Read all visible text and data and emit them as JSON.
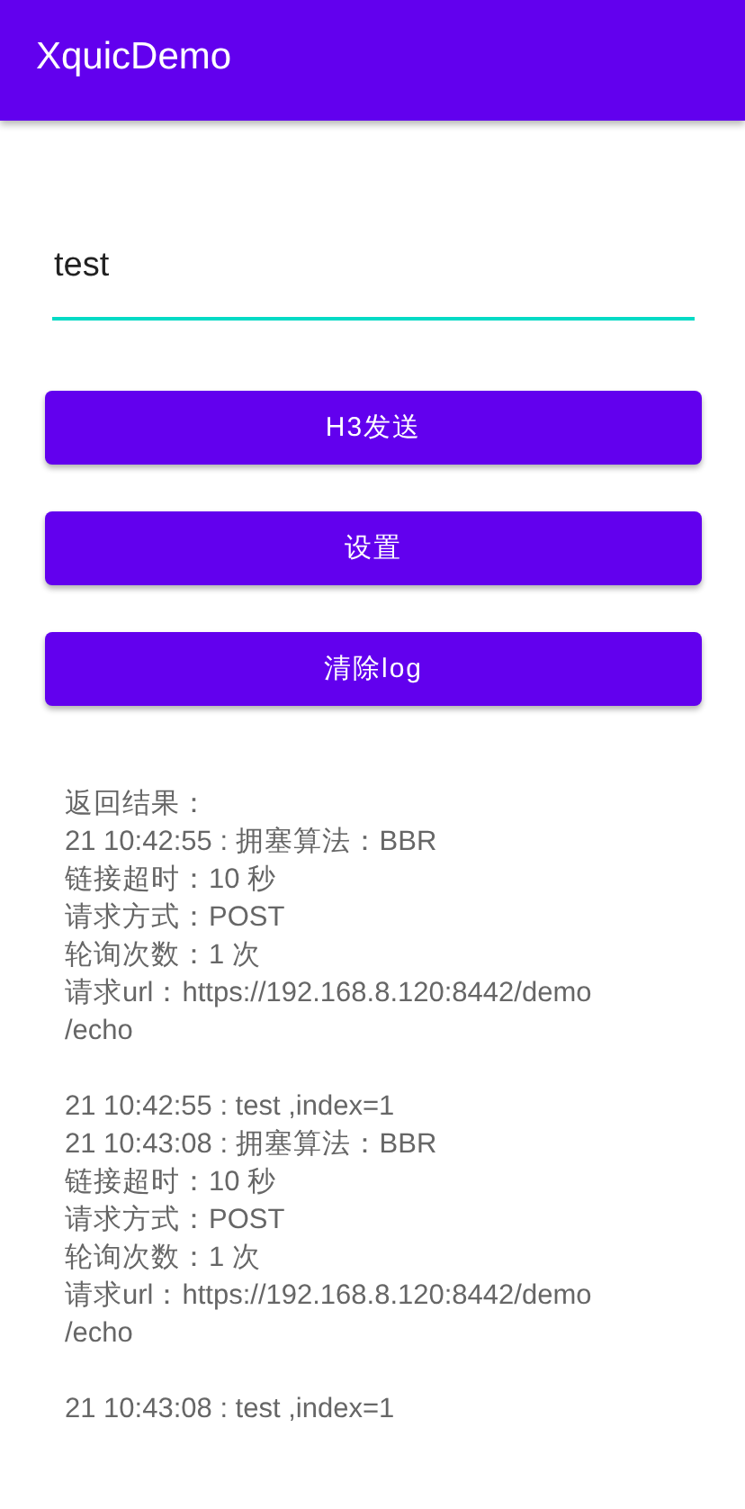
{
  "app_bar": {
    "title": "XquicDemo"
  },
  "input": {
    "value": "test"
  },
  "buttons": [
    "H3发送",
    "设置",
    "清除log"
  ],
  "log": [
    [
      "返回结果：",
      "21 10:42:55 : 拥塞算法：BBR",
      "链接超时：10 秒",
      "请求方式：POST",
      "轮询次数：1 次",
      "请求url：https://192.168.8.120:8442/demo",
      "/echo"
    ],
    [
      "21 10:42:55 : test ,index=1",
      "21 10:43:08 : 拥塞算法：BBR",
      "链接超时：10 秒",
      "请求方式：POST",
      "轮询次数：1 次",
      "请求url：https://192.168.8.120:8442/demo",
      "/echo"
    ],
    [
      "21 10:43:08 : test ,index=1"
    ]
  ]
}
